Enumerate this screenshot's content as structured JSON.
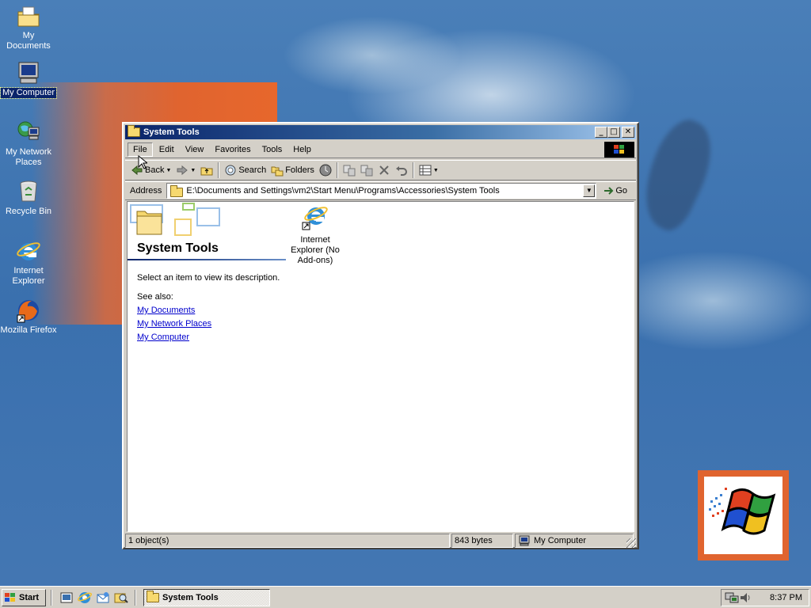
{
  "desktop": {
    "icons": [
      {
        "label": "My Documents",
        "icon": "my-documents-icon"
      },
      {
        "label": "My Computer",
        "icon": "my-computer-icon"
      },
      {
        "label": "My Network Places",
        "icon": "network-places-icon"
      },
      {
        "label": "Recycle Bin",
        "icon": "recycle-bin-icon"
      },
      {
        "label": "Internet Explorer",
        "icon": "internet-explorer-icon"
      },
      {
        "label": "Mozilla Firefox",
        "icon": "firefox-icon"
      }
    ]
  },
  "window": {
    "title": "System Tools",
    "controls": {
      "minimize": "_",
      "maximize": "□",
      "close": "✕"
    },
    "menu": [
      "File",
      "Edit",
      "View",
      "Favorites",
      "Tools",
      "Help"
    ],
    "toolbar": {
      "back": "Back",
      "search": "Search",
      "folders": "Folders"
    },
    "address": {
      "label": "Address",
      "value": "E:\\Documents and Settings\\vm2\\Start Menu\\Programs\\Accessories\\System Tools",
      "go": "Go"
    },
    "panel": {
      "heading": "System Tools",
      "description": "Select an item to view its description.",
      "see_also": "See also:",
      "links": [
        "My Documents",
        "My Network Places",
        "My Computer"
      ]
    },
    "items": [
      {
        "label": "Internet Explorer (No Add-ons)",
        "icon": "internet-explorer-shortcut-icon"
      }
    ],
    "status": {
      "objects": "1 object(s)",
      "size": "843 bytes",
      "location": "My Computer"
    }
  },
  "taskbar": {
    "start": "Start",
    "quick_launch": [
      "show-desktop-icon",
      "internet-explorer-icon",
      "outlook-express-icon",
      "search-icon"
    ],
    "task": "System Tools",
    "clock": "8:37 PM"
  },
  "colors": {
    "title_active": "#0a246a",
    "face": "#d4d0c8",
    "link": "#0000cc",
    "desktop": "#3a70ae",
    "accent_orange": "#e0642f"
  }
}
